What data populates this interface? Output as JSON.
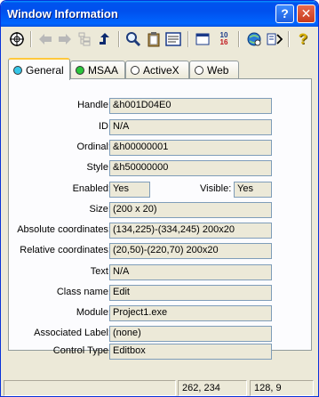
{
  "window": {
    "title": "Window Information"
  },
  "title_buttons": {
    "help": "?",
    "close": "✕"
  },
  "toolbar": {
    "icons": [
      "crosshair-icon",
      "back-arrow-icon",
      "forward-arrow-icon",
      "tree-icon",
      "up-arrow-icon",
      "find-icon",
      "clipboard-icon",
      "report-icon",
      "window-icon",
      "hex-icon",
      "refresh-globe-icon",
      "code-icon",
      "help-icon"
    ],
    "hex_glyph_top": "10",
    "hex_glyph_bottom": "16",
    "help_glyph": "?"
  },
  "tabs": [
    {
      "label": "General",
      "dot": "#35c6e8",
      "active": true
    },
    {
      "label": "MSAA",
      "dot": "#29c63a",
      "active": false
    },
    {
      "label": "ActiveX",
      "dot": "#ffffff",
      "active": false
    },
    {
      "label": "Web",
      "dot": "#ffffff",
      "active": false
    }
  ],
  "fields": {
    "handle": {
      "label": "Handle:",
      "value": "&h001D04E0"
    },
    "id": {
      "label": "ID:",
      "value": "N/A"
    },
    "ordinal": {
      "label": "Ordinal:",
      "value": "&h00000001"
    },
    "style": {
      "label": "Style:",
      "value": "&h50000000"
    },
    "enabled": {
      "label": "Enabled:",
      "value": "Yes"
    },
    "visible": {
      "label": "Visible:",
      "value": "Yes"
    },
    "size": {
      "label": "Size:",
      "value": "(200 x 20)"
    },
    "absolute": {
      "label": "Absolute coordinates:",
      "value": "(134,225)-(334,245) 200x20"
    },
    "relative": {
      "label": "Relative coordinates:",
      "value": "(20,50)-(220,70) 200x20"
    },
    "text": {
      "label": "Text:",
      "value": "N/A"
    },
    "class_name": {
      "label": "Class name:",
      "value": "Edit"
    },
    "module": {
      "label": "Module:",
      "value": "Project1.exe"
    },
    "assoc_label": {
      "label": "Associated Label:",
      "value": "(none)"
    },
    "control_type": {
      "label": "Control Type:",
      "value": "Editbox"
    }
  },
  "status": {
    "pane1": "",
    "pane2": "262, 234",
    "pane3": "128, 9"
  }
}
